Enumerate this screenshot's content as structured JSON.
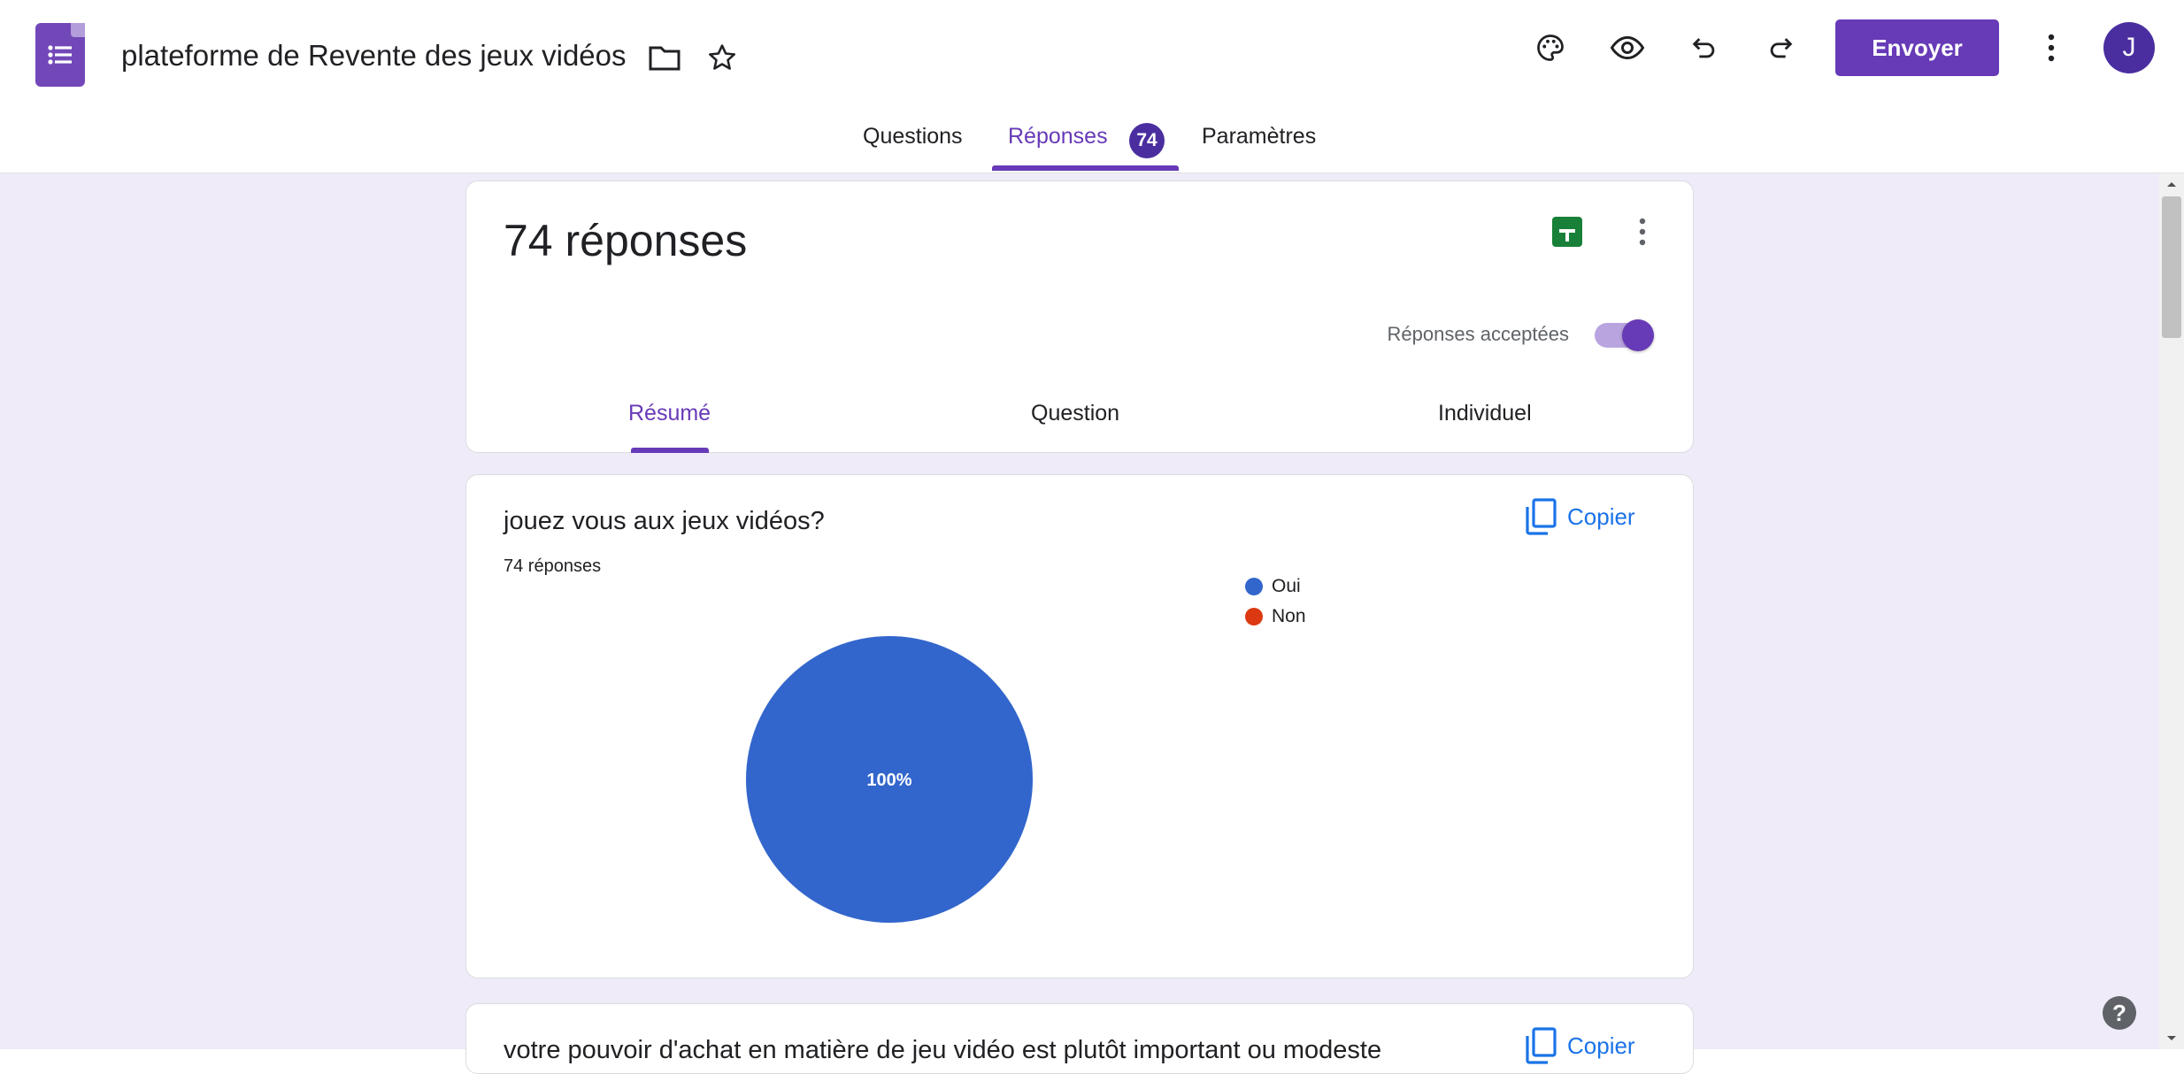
{
  "header": {
    "form_title": "plateforme de Revente des  jeux vidéos",
    "send_label": "Envoyer",
    "avatar_initial": "J",
    "accent_color": "#673ab7"
  },
  "tabs": [
    {
      "label": "Questions",
      "active": false
    },
    {
      "label": "Réponses",
      "active": true,
      "badge": "74"
    },
    {
      "label": "Paramètres",
      "active": false
    }
  ],
  "summary": {
    "response_count": "74 réponses",
    "accepting_label": "Réponses acceptées",
    "accepting": true,
    "subtabs": [
      {
        "label": "Résumé",
        "active": true
      },
      {
        "label": "Question",
        "active": false
      },
      {
        "label": "Individuel",
        "active": false
      }
    ]
  },
  "questions": [
    {
      "title": "jouez vous aux jeux vidéos?",
      "count": "74 réponses",
      "copy_label": "Copier",
      "chart_data": {
        "type": "pie",
        "categories": [
          "Oui",
          "Non"
        ],
        "values": [
          100,
          0
        ],
        "colors": [
          "#3366cc",
          "#dc3912"
        ],
        "data_labels": [
          "100%"
        ],
        "legend": "right"
      }
    },
    {
      "title": "votre pouvoir d'achat en matière de jeu vidéo est plutôt important ou modeste",
      "copy_label": "Copier"
    }
  ],
  "icons": {
    "title_folder": "folder-icon",
    "title_star": "star-icon",
    "palette": "palette-icon",
    "preview": "eye-icon",
    "undo": "undo-icon",
    "redo": "redo-icon",
    "more": "more-vert-icon",
    "sheets": "sheets-icon",
    "copy": "copy-icon",
    "help": "help-icon"
  }
}
